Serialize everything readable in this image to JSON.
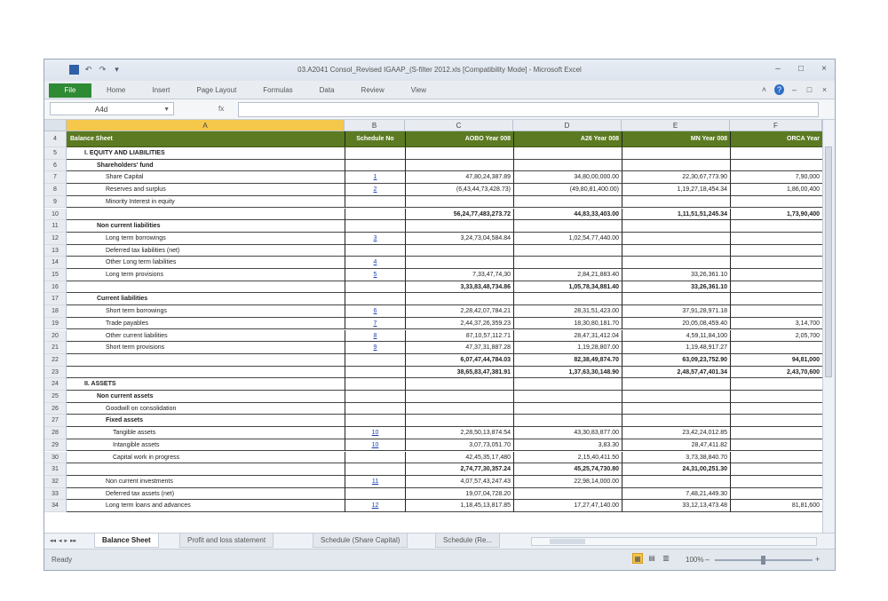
{
  "window": {
    "title": "03.A2041 Consol_Revised IGAAP_(S-filter 2012.xls [Compatibility Mode] - Microsoft Excel",
    "controls": [
      "–",
      "□",
      "×"
    ]
  },
  "quick_access": [
    "save",
    "↶",
    "↷",
    "▾"
  ],
  "ribbon": {
    "file_tab": "File",
    "tabs": [
      "Home",
      "Insert",
      "Page Layout",
      "Formulas",
      "Data",
      "Review",
      "View"
    ],
    "right_icons": [
      "˄",
      "?",
      "–",
      "□",
      "×"
    ]
  },
  "formula_bar": {
    "name_box": "A4d",
    "fx_label": "fx",
    "formula": ""
  },
  "columns": [
    "A",
    "B",
    "C",
    "D",
    "E",
    "F"
  ],
  "header_row": {
    "row_num": "4",
    "a": "Balance Sheet",
    "b": "Schedule No",
    "c": "AOBO Year 008",
    "d": "A26 Year 008",
    "e": "MN Year 008",
    "f": "ORCA Year"
  },
  "rows": [
    {
      "n": "5",
      "a": "I. EQUITY AND LIABILITIES",
      "indent": 1,
      "bold": true,
      "b": "",
      "c": "",
      "d": "",
      "e": "",
      "f": ""
    },
    {
      "n": "6",
      "a": "Shareholders' fund",
      "indent": 2,
      "bold": true,
      "b": "",
      "c": "",
      "d": "",
      "e": "",
      "f": ""
    },
    {
      "n": "7",
      "a": "Share Capital",
      "indent": 3,
      "bold": false,
      "b": "1",
      "c": "47,80,24,387.89",
      "d": "34,80,00,000.00",
      "e": "22,30,67,773.90",
      "f": "7,90,000"
    },
    {
      "n": "8",
      "a": "Reserves and surplus",
      "indent": 3,
      "bold": false,
      "b": "2",
      "c": "(6,43,44,73,428.73)",
      "d": "(49,80,81,400.00)",
      "e": "1,19,27,18,454.34",
      "f": "1,86,00,400"
    },
    {
      "n": "9",
      "a": "Minority Interest in equity",
      "indent": 3,
      "bold": false,
      "b": "",
      "c": "",
      "d": "",
      "e": "",
      "f": ""
    },
    {
      "n": "10",
      "a": "",
      "indent": 0,
      "bold": true,
      "b": "",
      "c": "56,24,77,483,273.72",
      "d": "44,83,33,403.00",
      "e": "1,11,51,51,245.34",
      "f": "1,73,90,400"
    },
    {
      "n": "11",
      "a": "Non current liabilities",
      "indent": 2,
      "bold": true,
      "b": "",
      "c": "",
      "d": "",
      "e": "",
      "f": ""
    },
    {
      "n": "12",
      "a": "Long term borrowings",
      "indent": 3,
      "bold": false,
      "b": "3",
      "c": "3,24,73,04,584.84",
      "d": "1,02,54,77,440.00",
      "e": "",
      "f": ""
    },
    {
      "n": "13",
      "a": "Deferred tax liabilities (net)",
      "indent": 3,
      "bold": false,
      "b": "",
      "c": "",
      "d": "",
      "e": "",
      "f": ""
    },
    {
      "n": "14",
      "a": "Other Long term liabilities",
      "indent": 3,
      "bold": false,
      "b": "4",
      "c": "",
      "d": "",
      "e": "",
      "f": ""
    },
    {
      "n": "15",
      "a": "Long term provisions",
      "indent": 3,
      "bold": false,
      "b": "5",
      "c": "7,33,47,74,30",
      "d": "2,84,21,883.40",
      "e": "33,26,361.10",
      "f": ""
    },
    {
      "n": "16",
      "a": "",
      "indent": 0,
      "bold": true,
      "b": "",
      "c": "3,33,83,48,734.86",
      "d": "1,05,78,34,881.40",
      "e": "33,26,361.10",
      "f": ""
    },
    {
      "n": "17",
      "a": "Current liabilities",
      "indent": 2,
      "bold": true,
      "b": "",
      "c": "",
      "d": "",
      "e": "",
      "f": ""
    },
    {
      "n": "18",
      "a": "Short term borrowings",
      "indent": 3,
      "bold": false,
      "b": "6",
      "c": "2,28,42,07,784.21",
      "d": "28,31,51,423.00",
      "e": "37,91,28,971.18",
      "f": ""
    },
    {
      "n": "19",
      "a": "Trade payables",
      "indent": 3,
      "bold": false,
      "b": "7",
      "c": "2,44,37,26,359.23",
      "d": "18,30,80,181.70",
      "e": "20,05,08,459.40",
      "f": "3,14,700"
    },
    {
      "n": "20",
      "a": "Other current liabilities",
      "indent": 3,
      "bold": false,
      "b": "8",
      "c": "87,10,57,112.71",
      "d": "28,47,31,412.04",
      "e": "4,59,11,84,100",
      "f": "2,05,700"
    },
    {
      "n": "21",
      "a": "Short term provisions",
      "indent": 3,
      "bold": false,
      "b": "9",
      "c": "47,37,31,887.28",
      "d": "1,19,28,807.00",
      "e": "1,19,48,917.27",
      "f": ""
    },
    {
      "n": "22",
      "a": "",
      "indent": 0,
      "bold": true,
      "b": "",
      "c": "6,07,47,44,784.03",
      "d": "82,38,49,874.70",
      "e": "63,09,23,752.90",
      "f": "94,81,000"
    },
    {
      "n": "23",
      "a": "",
      "indent": 0,
      "bold": true,
      "b": "",
      "c": "38,65,83,47,381.91",
      "d": "1,37,63,30,148.90",
      "e": "2,48,57,47,401.34",
      "f": "2,43,70,600"
    },
    {
      "n": "24",
      "a": "II. ASSETS",
      "indent": 1,
      "bold": true,
      "b": "",
      "c": "",
      "d": "",
      "e": "",
      "f": ""
    },
    {
      "n": "25",
      "a": "Non current assets",
      "indent": 2,
      "bold": true,
      "b": "",
      "c": "",
      "d": "",
      "e": "",
      "f": ""
    },
    {
      "n": "26",
      "a": "Goodwill on consolidation",
      "indent": 3,
      "bold": false,
      "b": "",
      "c": "",
      "d": "",
      "e": "",
      "f": ""
    },
    {
      "n": "27",
      "a": "Fixed assets",
      "indent": 3,
      "bold": true,
      "b": "",
      "c": "",
      "d": "",
      "e": "",
      "f": ""
    },
    {
      "n": "28",
      "a": "Tangible assets",
      "indent": 4,
      "bold": false,
      "b": "10",
      "c": "2,28,50,13,874.54",
      "d": "43,30,83,877.00",
      "e": "23,42,24,012.85",
      "f": ""
    },
    {
      "n": "29",
      "a": "Intangible assets",
      "indent": 4,
      "bold": false,
      "b": "10",
      "c": "3,07,73,051.70",
      "d": "3,83.30",
      "e": "28,47,411.82",
      "f": ""
    },
    {
      "n": "30",
      "a": "Capital work in progress",
      "indent": 4,
      "bold": false,
      "b": "",
      "c": "42,45,35,17,480",
      "d": "2,15,40,411.50",
      "e": "3,73,38,840.70",
      "f": ""
    },
    {
      "n": "31",
      "a": "",
      "indent": 0,
      "bold": true,
      "b": "",
      "c": "2,74,77,30,357.24",
      "d": "45,25,74,730.80",
      "e": "24,31,00,251.30",
      "f": ""
    },
    {
      "n": "32",
      "a": "Non current investments",
      "indent": 3,
      "bold": false,
      "b": "11",
      "c": "4,07,57,43,247.43",
      "d": "22,98,14,000.00",
      "e": "",
      "f": ""
    },
    {
      "n": "33",
      "a": "Deferred tax assets (net)",
      "indent": 3,
      "bold": false,
      "b": "",
      "c": "19,07,04,728.20",
      "d": "",
      "e": "7,48,21,449.30",
      "f": ""
    },
    {
      "n": "34",
      "a": "Long term loans and advances",
      "indent": 3,
      "bold": false,
      "b": "12",
      "c": "1,18,45,13,817.85",
      "d": "17,27,47,140.00",
      "e": "33,12,13,473.48",
      "f": "81,81,600"
    }
  ],
  "sheet_tabs": {
    "nav": [
      "◂◂",
      "◂",
      "▸",
      "▸▸"
    ],
    "tabs": [
      "Balance Sheet",
      "Profit and loss statement",
      "Schedule (Share Capital)",
      "Schedule (Re..."
    ]
  },
  "status": {
    "text": "Ready",
    "zoom": "100%",
    "minus": "–",
    "plus": "+"
  }
}
